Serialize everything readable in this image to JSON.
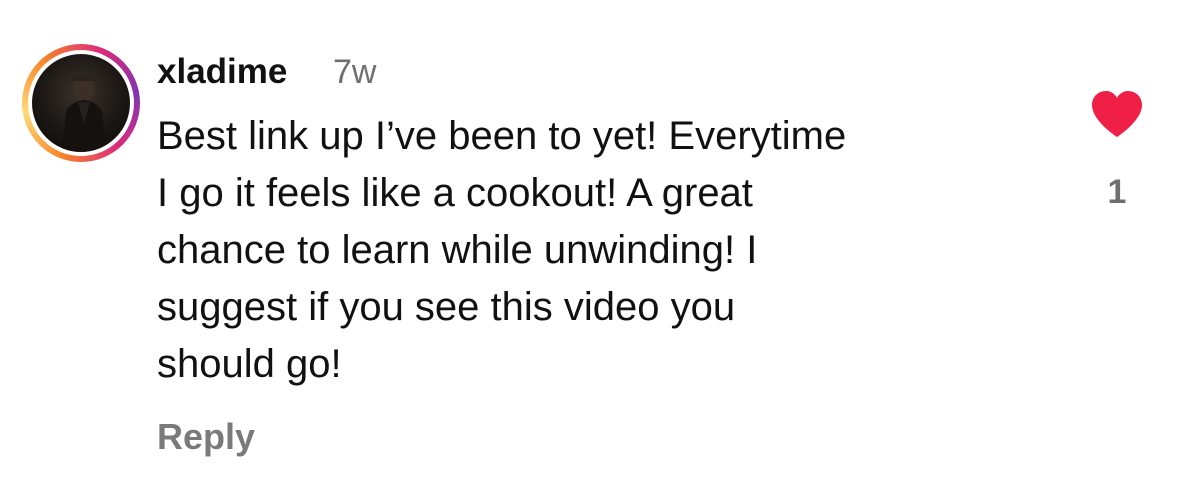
{
  "comment": {
    "username": "xladime",
    "timestamp": "7w",
    "text_lines": [
      "Best link up I’ve been to yet! Everytime",
      "I go it feels like a cookout! A great",
      "chance to learn while unwinding! I",
      "suggest if you see this video you",
      "should go!"
    ],
    "reply_label": "Reply",
    "like": {
      "liked": true,
      "count": "1",
      "icon": "heart-filled-icon",
      "color": "#ef1f48"
    },
    "avatar": {
      "ring_colors": [
        "#f58529",
        "#feda77",
        "#dd2a7b",
        "#8134af"
      ]
    }
  }
}
